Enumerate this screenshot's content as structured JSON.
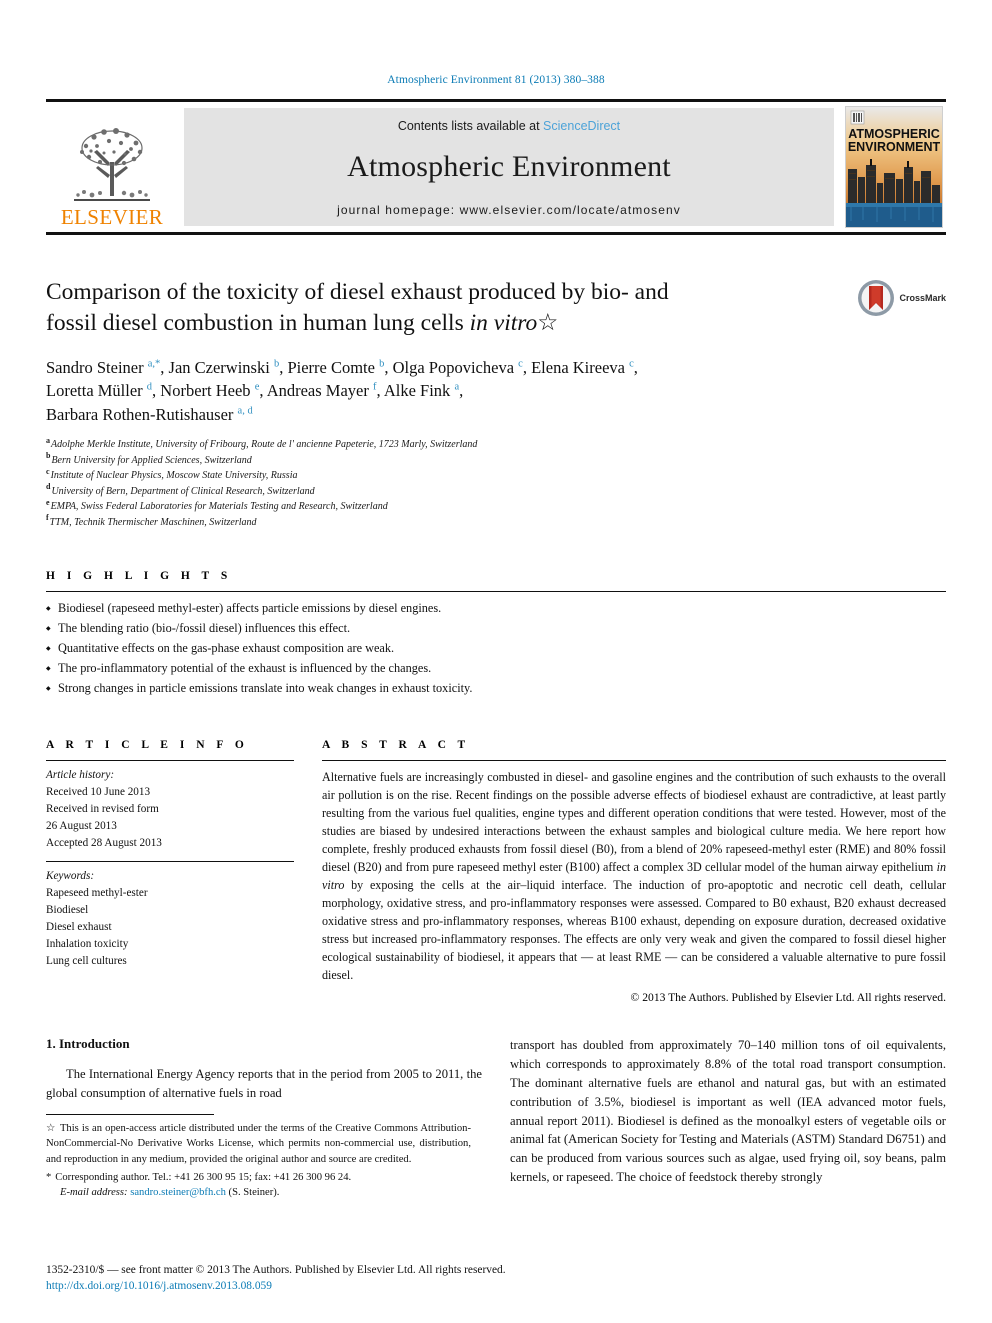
{
  "running_head": "Atmospheric Environment 81 (2013) 380–388",
  "masthead": {
    "publisher_name": "ELSEVIER",
    "contents_prefix": "Contents lists available at",
    "contents_link": "ScienceDirect",
    "journal_title": "Atmospheric Environment",
    "homepage": "journal homepage: www.elsevier.com/locate/atmosenv",
    "cover_line1": "ATMOSPHERIC",
    "cover_line2": "ENVIRONMENT"
  },
  "article": {
    "title_line1": "Comparison of the toxicity of diesel exhaust produced by bio- and",
    "title_line2_pre": "fossil diesel combustion in human lung cells ",
    "title_line2_italic": "in vitro",
    "title_dagger": "☆",
    "crossmark_label": "CrossMark",
    "authors": [
      {
        "name": "Sandro Steiner",
        "marks": "a,*"
      },
      {
        "name": "Jan Czerwinski",
        "marks": "b"
      },
      {
        "name": "Pierre Comte",
        "marks": "b"
      },
      {
        "name": "Olga Popovicheva",
        "marks": "c"
      },
      {
        "name": "Elena Kireeva",
        "marks": "c"
      },
      {
        "name": "Loretta Müller",
        "marks": "d"
      },
      {
        "name": "Norbert Heeb",
        "marks": "e"
      },
      {
        "name": "Andreas Mayer",
        "marks": "f"
      },
      {
        "name": "Alke Fink",
        "marks": "a"
      },
      {
        "name": "Barbara Rothen-Rutishauser",
        "marks": "a, d"
      }
    ],
    "affiliations": [
      {
        "mark": "a",
        "text": "Adolphe Merkle Institute, University of Fribourg, Route de l' ancienne Papeterie, 1723 Marly, Switzerland"
      },
      {
        "mark": "b",
        "text": "Bern University for Applied Sciences, Switzerland"
      },
      {
        "mark": "c",
        "text": "Institute of Nuclear Physics, Moscow State University, Russia"
      },
      {
        "mark": "d",
        "text": "University of Bern, Department of Clinical Research, Switzerland"
      },
      {
        "mark": "e",
        "text": "EMPA, Swiss Federal Laboratories for Materials Testing and Research, Switzerland"
      },
      {
        "mark": "f",
        "text": "TTM, Technik Thermischer Maschinen, Switzerland"
      }
    ]
  },
  "highlights": {
    "heading": "H I G H L I G H T S",
    "items": [
      "Biodiesel (rapeseed methyl-ester) affects particle emissions by diesel engines.",
      "The blending ratio (bio-/fossil diesel) influences this effect.",
      "Quantitative effects on the gas-phase exhaust composition are weak.",
      "The pro-inflammatory potential of the exhaust is influenced by the changes.",
      "Strong changes in particle emissions translate into weak changes in exhaust toxicity."
    ]
  },
  "article_info": {
    "heading": "A R T I C L E  I N F O",
    "history_label": "Article history:",
    "history": [
      "Received 10 June 2013",
      "Received in revised form",
      "26 August 2013",
      "Accepted 28 August 2013"
    ],
    "keywords_label": "Keywords:",
    "keywords": [
      "Rapeseed methyl-ester",
      "Biodiesel",
      "Diesel exhaust",
      "Inhalation toxicity",
      "Lung cell cultures"
    ]
  },
  "abstract": {
    "heading": "A B S T R A C T",
    "part1": "Alternative fuels are increasingly combusted in diesel- and gasoline engines and the contribution of such exhausts to the overall air pollution is on the rise. Recent findings on the possible adverse effects of biodiesel exhaust are contradictive, at least partly resulting from the various fuel qualities, engine types and different operation conditions that were tested. However, most of the studies are biased by undesired interactions between the exhaust samples and biological culture media. We here report how complete, freshly produced exhausts from fossil diesel (B0), from a blend of 20% rapeseed-methyl ester (RME) and 80% fossil diesel (B20) and from pure rapeseed methyl ester (B100) affect a complex 3D cellular model of the human airway epithelium ",
    "italic1": "in vitro",
    "part2": " by exposing the cells at the air–liquid interface. The induction of pro-apoptotic and necrotic cell death, cellular morphology, oxidative stress, and pro-inflammatory responses were assessed. Compared to B0 exhaust, B20 exhaust decreased oxidative stress and pro-inflammatory responses, whereas B100 exhaust, depending on exposure duration, decreased oxidative stress but increased pro-inflammatory responses. The effects are only very weak and given the compared to fossil diesel higher ecological sustainability of biodiesel, it appears that — at least RME — can be considered a valuable alternative to pure fossil diesel.",
    "copyright": "© 2013 The Authors. Published by Elsevier Ltd. All rights reserved."
  },
  "introduction": {
    "heading": "1. Introduction",
    "left_paragraph": "The International Energy Agency reports that in the period from 2005 to 2011, the global consumption of alternative fuels in road",
    "right_paragraph": "transport has doubled from approximately 70–140 million tons of oil equivalents, which corresponds to approximately 8.8% of the total road transport consumption. The dominant alternative fuels are ethanol and natural gas, but with an estimated contribution of 3.5%, biodiesel is important as well (IEA advanced motor fuels, annual report 2011). Biodiesel is defined as the monoalkyl esters of vegetable oils or animal fat (American Society for Testing and Materials (ASTM) Standard D6751) and can be produced from various sources such as algae, used frying oil, soy beans, palm kernels, or rapeseed. The choice of feedstock thereby strongly"
  },
  "footnotes": {
    "license_mark": "☆",
    "license_text": "This is an open-access article distributed under the terms of the Creative Commons Attribution-NonCommercial-No Derivative Works License, which permits non-commercial use, distribution, and reproduction in any medium, provided the original author and source are credited.",
    "corresponding_mark": "*",
    "corresponding_text": "Corresponding author. Tel.: +41 26 300 95 15; fax: +41 26 300 96 24.",
    "email_label": "E-mail address:",
    "email": "sandro.steiner@bfh.ch",
    "email_suffix": "(S. Steiner)."
  },
  "page_footer": {
    "line1": "1352-2310/$ — see front matter © 2013 The Authors. Published by Elsevier Ltd. All rights reserved.",
    "doi": "http://dx.doi.org/10.1016/j.atmosenv.2013.08.059"
  },
  "colors": {
    "link_blue": "#0b7bb5",
    "sciencedirect_blue": "#4da3d8",
    "elsevier_orange": "#ef8200",
    "affiliation_mark_blue": "#2f8fc0",
    "masthead_gray": "#e3e3e3"
  }
}
